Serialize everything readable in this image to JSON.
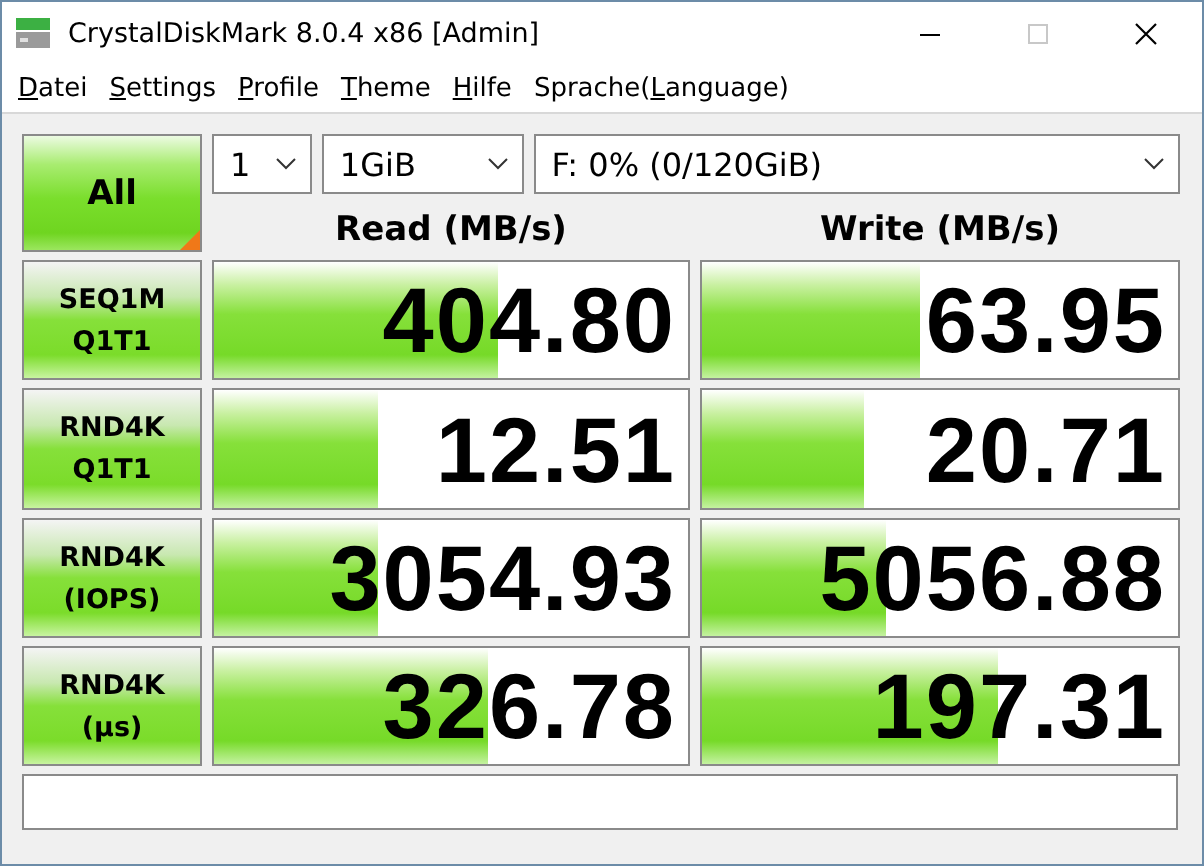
{
  "window": {
    "title": "CrystalDiskMark 8.0.4 x86 [Admin]"
  },
  "menu": [
    {
      "key": "D",
      "after": "atei"
    },
    {
      "key": "S",
      "after": "ettings"
    },
    {
      "key": "P",
      "after": "rofile"
    },
    {
      "key": "T",
      "after": "heme"
    },
    {
      "key": "H",
      "after": "ilfe"
    },
    {
      "before": "Sprache(",
      "key": "L",
      "after": "anguage)"
    }
  ],
  "all_button": "All",
  "dropdowns": [
    {
      "value": "1"
    },
    {
      "value": "1GiB"
    },
    {
      "value": "F: 0% (0/120GiB)"
    }
  ],
  "columns": [
    "Read (MB/s)",
    "Write (MB/s)"
  ],
  "tests": [
    {
      "line1": "SEQ1M",
      "line2": "Q1T1",
      "read": {
        "value": "404.80",
        "level": 0.6
      },
      "write": {
        "value": "63.95",
        "level": 0.46
      }
    },
    {
      "line1": "RND4K",
      "line2": "Q1T1",
      "read": {
        "value": "12.51",
        "level": 0.345
      },
      "write": {
        "value": "20.71",
        "level": 0.34
      }
    },
    {
      "line1": "RND4K",
      "line2": "(IOPS)",
      "read": {
        "value": "3054.93",
        "level": 0.345
      },
      "write": {
        "value": "5056.88",
        "level": 0.385
      }
    },
    {
      "line1": "RND4K",
      "line2": "(μs)",
      "read": {
        "value": "326.78",
        "level": 0.58
      },
      "write": {
        "value": "197.31",
        "level": 0.62
      }
    }
  ]
}
